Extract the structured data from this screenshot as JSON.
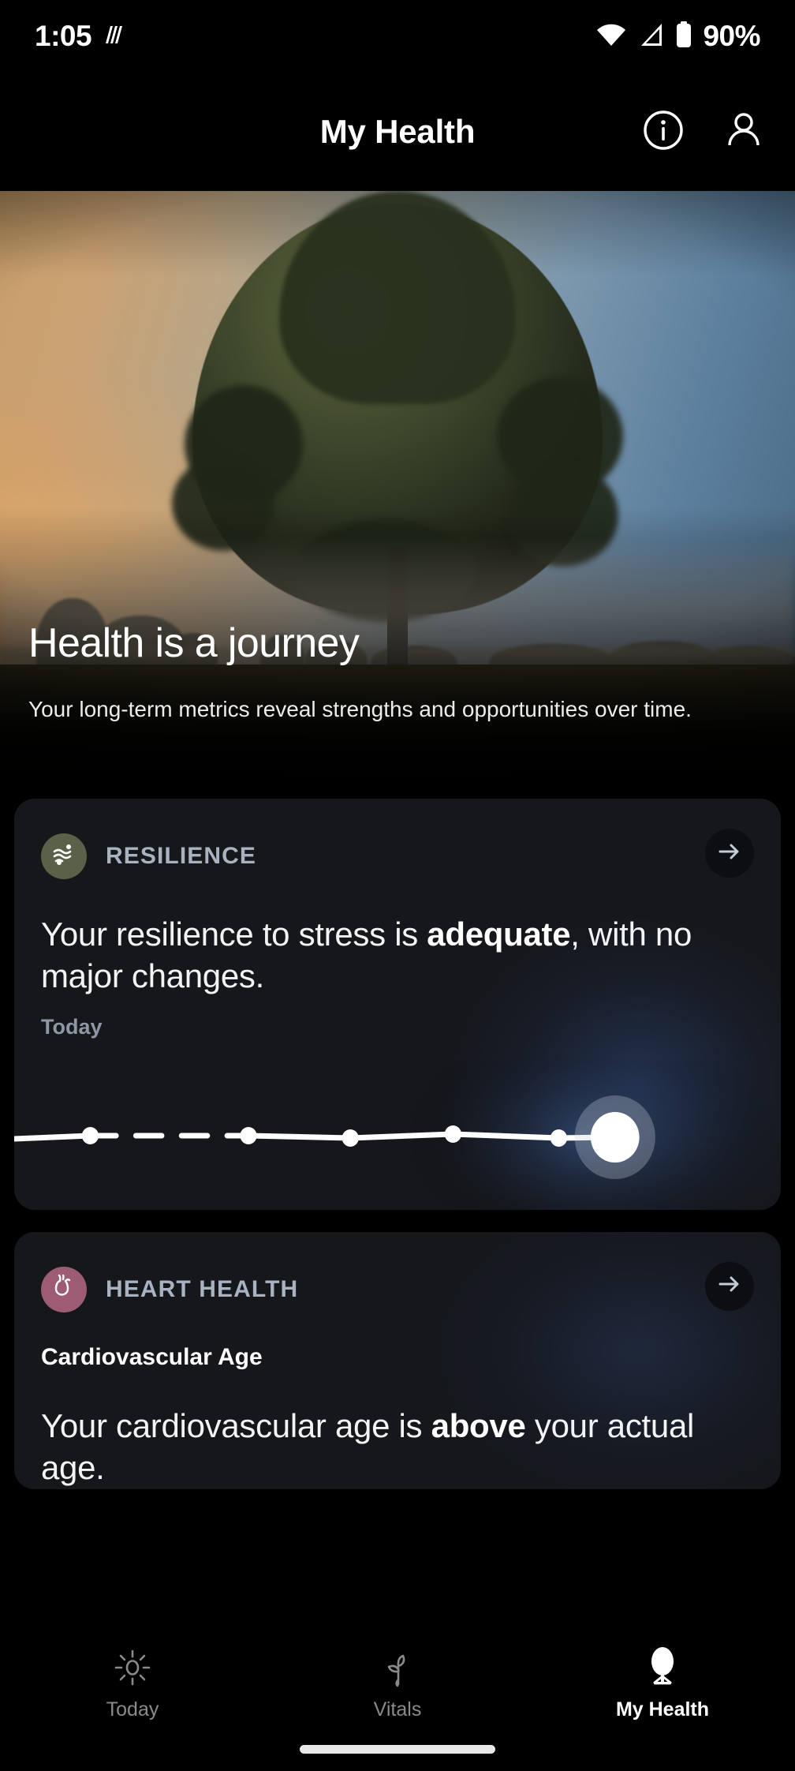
{
  "status_bar": {
    "time": "1:05",
    "battery_percent": "90%",
    "icons": [
      "alarm-stack-icon",
      "wifi-icon",
      "cellular-signal-icon",
      "battery-icon"
    ]
  },
  "header": {
    "title": "My Health",
    "info_icon": "info-circle-icon",
    "profile_icon": "person-icon"
  },
  "hero": {
    "title": "Health is a journey",
    "subtitle": "Your long-term metrics reveal strengths and opportunities over time.",
    "image_description": "tree-at-dawn-photo"
  },
  "cards": [
    {
      "category": "RESILIENCE",
      "badge_icon": "ripple-waves-icon",
      "badge_color": "#5a6148",
      "arrow_icon": "arrow-right-icon",
      "headline_prefix": "Your resilience to stress is ",
      "headline_emphasis": "adequate",
      "headline_suffix": ", with no major changes.",
      "timeframe": "Today",
      "chart_data": {
        "type": "line",
        "title": "Resilience trend",
        "x": [
          0,
          1,
          2,
          3,
          4,
          5,
          6,
          7
        ],
        "values": [
          50,
          50,
          50,
          51,
          50,
          48,
          50,
          50
        ],
        "point_style": [
          "none",
          "dot",
          "gap",
          "dot",
          "dot",
          "dot",
          "dot",
          "marker-glow"
        ],
        "dashed_segment_between": [
          1,
          3
        ],
        "line_color": "#ffffff",
        "marker_color": "#ffffff",
        "marker_halo_color": "rgba(200,208,220,0.30)",
        "grid": false,
        "axis_labels": false
      }
    },
    {
      "category": "HEART HEALTH",
      "badge_icon": "anatomical-heart-icon",
      "badge_color": "#9d5c74",
      "arrow_icon": "arrow-right-icon",
      "metric_title": "Cardiovascular Age",
      "headline_prefix": "Your cardiovascular age is ",
      "headline_emphasis": "above",
      "headline_suffix": " your actual age."
    }
  ],
  "bottom_nav": {
    "items": [
      {
        "label": "Today",
        "icon": "sun-icon",
        "active": false
      },
      {
        "label": "Vitals",
        "icon": "sprout-leaf-icon",
        "active": false
      },
      {
        "label": "My Health",
        "icon": "tree-icon",
        "active": true
      }
    ]
  }
}
